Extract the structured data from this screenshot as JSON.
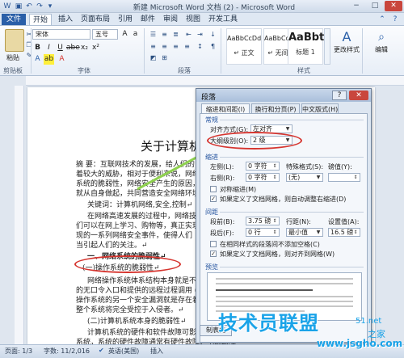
{
  "window": {
    "title": "新建 Microsoft Word 文档 (2) - Microsoft Word",
    "minimize": "−",
    "maximize": "□",
    "close": "✕"
  },
  "tabs": [
    "文件",
    "开始",
    "插入",
    "页面布局",
    "引用",
    "邮件",
    "审阅",
    "视图",
    "开发工具"
  ],
  "ribbon": {
    "paste": "粘贴",
    "clipboard_group": "剪贴板",
    "font_name": "宋体",
    "font_size": "五号",
    "font_group": "字体",
    "paragraph_group": "段落",
    "styles_group": "样式",
    "styles": [
      {
        "sample": "AaBbCcDd",
        "name": "↵ 正文"
      },
      {
        "sample": "AaBbCcDd",
        "name": "↵ 无间隔"
      },
      {
        "sample": "AaBbt",
        "name": "标题 1"
      }
    ],
    "change_style": "更改样式",
    "editing": "编辑"
  },
  "document": {
    "title": "关于计算机网",
    "lines": [
      "摘 要：互联网技术的发展，给人们的",
      "着较大的威胁，相对于便利来说，网络",
      "系统的脆弱性，网络安全产生的原因，",
      "就从自身做起，共同营造安全网络环境",
      "关键词：计算机网络,安全,控制↵",
      "在网络高速发展的过程中，网络技",
      "们可以在网上学习、购物等，真正实现",
      "现的一系列网络安全事件，使得人们",
      "当引起人们的关注。↵",
      "一、网络系统的脆弱性↵",
      "(一)操作系统的脆弱性↵",
      "网络操作系统体系结构本身就是不",
      "的无口令入口和提供的远程过程调用 (",
      "操作系统的另一个安全漏洞就是存在着",
      "整个系统将完全受控于入侵者。↵",
      "(二)计算机系统本身的脆弱性↵",
      "计算机系统的硬件和软件故障可影",
      "系统，系统的硬件故障通常有硬件故障、电源故障"
    ]
  },
  "dialog": {
    "title": "段落",
    "help": "?",
    "close": "✕",
    "tabs": [
      "缩进和间距(I)",
      "换行和分页(P)",
      "中文版式(H)"
    ],
    "general_section": "常规",
    "alignment_label": "对齐方式(G):",
    "alignment_value": "左对齐",
    "outline_label": "大纲级别(O):",
    "outline_value": "2 级",
    "indent_section": "缩进",
    "left_label": "左侧(L):",
    "left_value": "0 字符",
    "right_label": "右侧(R):",
    "right_value": "0 字符",
    "special_label": "特殊格式(S):",
    "special_value": "(无)",
    "measure_label": "磅值(Y):",
    "mirror_label": "对称缩进(M)",
    "auto_indent_label": "如果定义了文档网格，则自动调整右缩进(D)",
    "spacing_section": "间距",
    "before_label": "段前(B):",
    "before_value": "3.75 磅",
    "after_label": "段后(F):",
    "after_value": "0 行",
    "line_spacing_label": "行距(N):",
    "line_spacing_value": "最小值",
    "at_label": "设置值(A):",
    "at_value": "16.5 磅",
    "no_space_label": "在相同样式的段落间不添加空格(C)",
    "snap_grid_label": "如果定义了文档网格，则对齐到网格(W)",
    "preview_section": "预览",
    "tabs_button": "制表位"
  },
  "status": {
    "page": "页面: 1/3",
    "words": "字数: 11/2,016",
    "language": "英语(美国)",
    "mode": "插入"
  },
  "watermark": {
    "logo": "技术员联盟",
    "url": "www.jsgho.com",
    "suffix": "51.net",
    "home": "之家"
  },
  "colors": {
    "accent": "#2a5fa8",
    "annotation_red": "#d6352f",
    "annotation_green": "#8fd14f",
    "watermark_blue": "#1aa3e8"
  }
}
